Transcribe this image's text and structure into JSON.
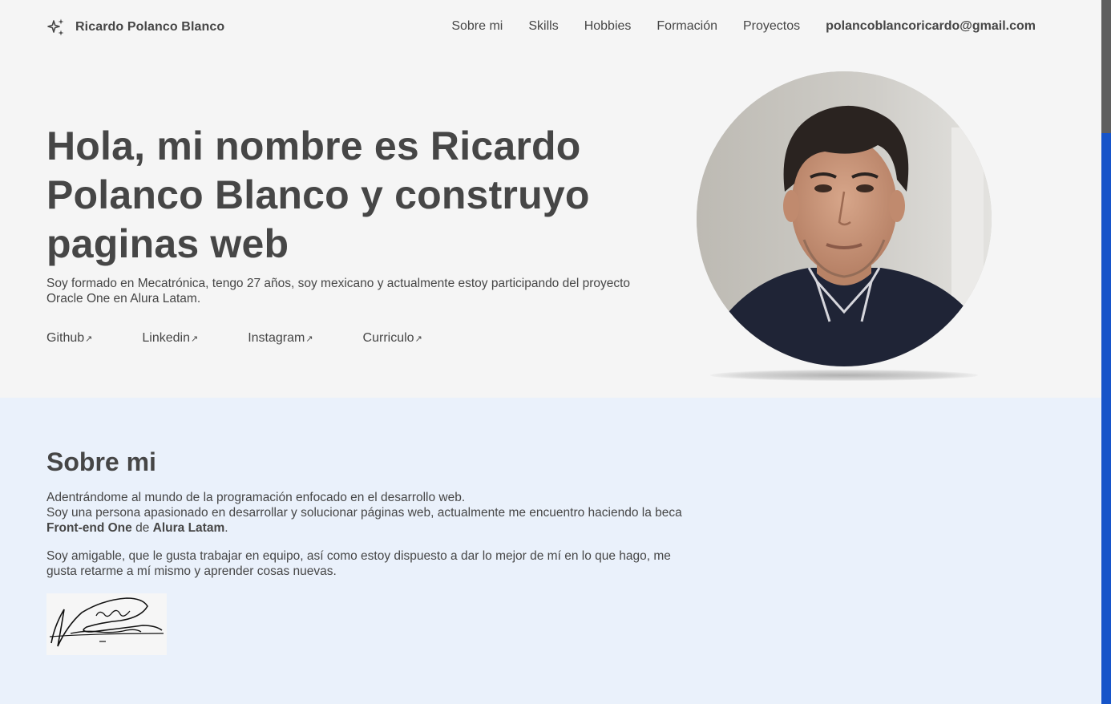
{
  "header": {
    "logo_icon": "sparkles-icon",
    "name": "Ricardo Polanco Blanco",
    "nav": [
      {
        "label": "Sobre mi"
      },
      {
        "label": "Skills"
      },
      {
        "label": "Hobbies"
      },
      {
        "label": "Formación"
      },
      {
        "label": "Proyectos"
      }
    ],
    "email": "polancoblancoricardo@gmail.com"
  },
  "hero": {
    "title": "Hola, mi nombre es Ricardo Polanco Blanco y construyo paginas web",
    "description": "Soy formado en Mecatrónica, tengo 27 años, soy mexicano y actualmente estoy participando del proyecto Oracle One en Alura Latam.",
    "links": [
      {
        "label": "Github"
      },
      {
        "label": "Linkedin"
      },
      {
        "label": "Instagram"
      },
      {
        "label": "Curriculo"
      }
    ],
    "link_icon": "arrow-up-right-icon"
  },
  "about": {
    "title": "Sobre mi",
    "p1_line1": "Adentrándome al mundo de la programación enfocado en el desarrollo web.",
    "p1_line2": "Soy una persona apasionado en desarrollar y solucionar páginas web, actualmente me encuentro haciendo la beca ",
    "p1_bold1": "Front-end One",
    "p1_mid": " de ",
    "p1_bold2": "Alura Latam",
    "p1_end": ".",
    "p2": "Soy amigable, que le gusta trabajar en equipo, así como estoy dispuesto a dar lo mejor de mí en lo que hago, me gusta retarme a mí mismo y aprender cosas nuevas.",
    "signature_text": "Ricardo Polanco"
  },
  "colors": {
    "text": "#464646",
    "hero_bg": "#f5f5f5",
    "about_bg": "#eaf1fb",
    "scrollbar_track": "#1654c9",
    "scrollbar_thumb": "#5f5f5f"
  }
}
